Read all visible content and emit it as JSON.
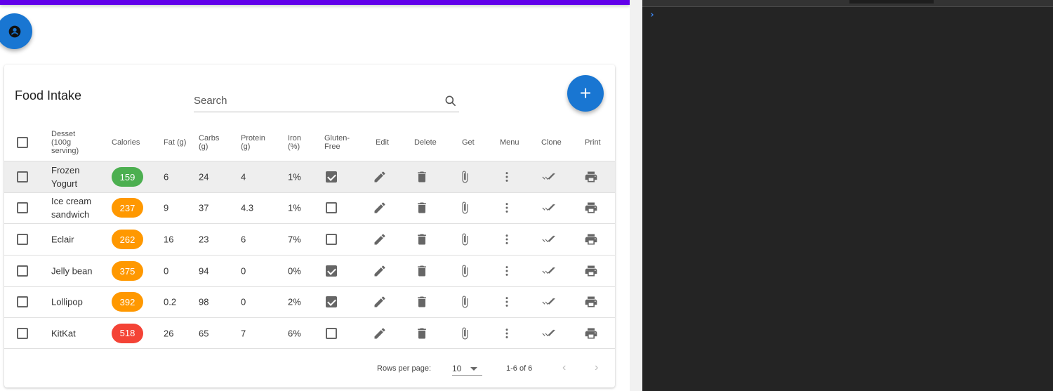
{
  "app": {
    "accent": "#6200ea",
    "primary": "#1976d2"
  },
  "devtools": {
    "prompt": "›"
  },
  "card": {
    "title": "Food Intake",
    "search": {
      "placeholder": "Search",
      "value": ""
    },
    "add_label": "+",
    "columns": [
      "Desset (100g serving)",
      "Calories",
      "Fat (g)",
      "Carbs (g)",
      "Protein (g)",
      "Iron (%)",
      "Gluten-Free",
      "Edit",
      "Delete",
      "Get",
      "Menu",
      "Clone",
      "Print"
    ],
    "rows": [
      {
        "name": "Frozen Yogurt",
        "calories": "159",
        "fat": "6",
        "carbs": "24",
        "protein": "4",
        "iron": "1%",
        "gluten_free": true,
        "color": "#4caf50",
        "selected": false
      },
      {
        "name": "Ice cream sandwich",
        "calories": "237",
        "fat": "9",
        "carbs": "37",
        "protein": "4.3",
        "iron": "1%",
        "gluten_free": false,
        "color": "#ff9800",
        "selected": false
      },
      {
        "name": "Eclair",
        "calories": "262",
        "fat": "16",
        "carbs": "23",
        "protein": "6",
        "iron": "7%",
        "gluten_free": false,
        "color": "#ff9800",
        "selected": false
      },
      {
        "name": "Jelly bean",
        "calories": "375",
        "fat": "0",
        "carbs": "94",
        "protein": "0",
        "iron": "0%",
        "gluten_free": true,
        "color": "#ff9800",
        "selected": false
      },
      {
        "name": "Lollipop",
        "calories": "392",
        "fat": "0.2",
        "carbs": "98",
        "protein": "0",
        "iron": "2%",
        "gluten_free": true,
        "color": "#ff9800",
        "selected": false
      },
      {
        "name": "KitKat",
        "calories": "518",
        "fat": "26",
        "carbs": "65",
        "protein": "7",
        "iron": "6%",
        "gluten_free": false,
        "color": "#f44336",
        "selected": false
      }
    ],
    "footer": {
      "rows_per_page_label": "Rows per page:",
      "rows_per_page": "10",
      "range": "1-6 of 6"
    }
  }
}
